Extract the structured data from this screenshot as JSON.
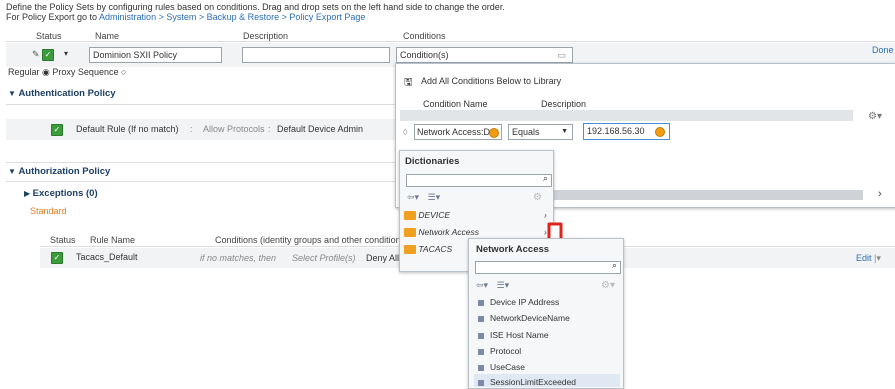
{
  "intro": {
    "line1": "Define the Policy Sets by configuring rules based on conditions. Drag and drop sets on the left hand side to change the order.",
    "line2_prefix": "For Policy Export go to ",
    "line2_link": "Administration > System > Backup & Restore > Policy Export Page"
  },
  "policy_table": {
    "headers": {
      "status": "Status",
      "name": "Name",
      "description": "Description",
      "conditions": "Conditions"
    },
    "name_value": "Dominion SXII Policy",
    "description_value": "",
    "condition_value": "Condition(s)",
    "done": "Done"
  },
  "mode": {
    "regular": "Regular",
    "proxy": "Proxy Sequence"
  },
  "authentication": {
    "title": "Authentication Policy",
    "default_rule": "Default Rule (If no match)",
    "allow_protocols": "Allow Protocols",
    "default_device_admin": "Default Device Admin"
  },
  "authorization": {
    "title": "Authorization Policy",
    "exceptions": "Exceptions (0)",
    "standard": "Standard",
    "headers": {
      "status": "Status",
      "rule_name": "Rule Name",
      "conditions": "Conditions (identity groups and other conditions"
    },
    "row": {
      "name": "Tacacs_Default",
      "if_no_match": "if no matches, then",
      "select_profile": "Select Profile(s)",
      "deny": "Deny All Shell Profile",
      "edit": "Edit"
    }
  },
  "condition_panel": {
    "add_all": "Add All Conditions Below to Library",
    "col_condition": "Condition Name",
    "col_description": "Description",
    "attribute": "Network Access:D",
    "operator": "Equals",
    "value": "192.168.56.30"
  },
  "dictionaries": {
    "title": "Dictionaries",
    "search_value": "",
    "items": [
      {
        "label": "DEVICE"
      },
      {
        "label": "Network Access"
      },
      {
        "label": "TACACS"
      }
    ]
  },
  "network_access": {
    "title": "Network Access",
    "search_value": "",
    "items": [
      {
        "label": "Device IP Address"
      },
      {
        "label": "NetworkDeviceName"
      },
      {
        "label": "ISE Host Name"
      },
      {
        "label": "Protocol"
      },
      {
        "label": "UseCase"
      },
      {
        "label": "SessionLimitExceeded"
      }
    ]
  },
  "colors": {
    "accent_link": "#2a6ebb",
    "check_green": "#3a9c3a",
    "folder": "#f0a020",
    "arrow_red": "#e0241b",
    "standard_orange": "#e67e22"
  }
}
